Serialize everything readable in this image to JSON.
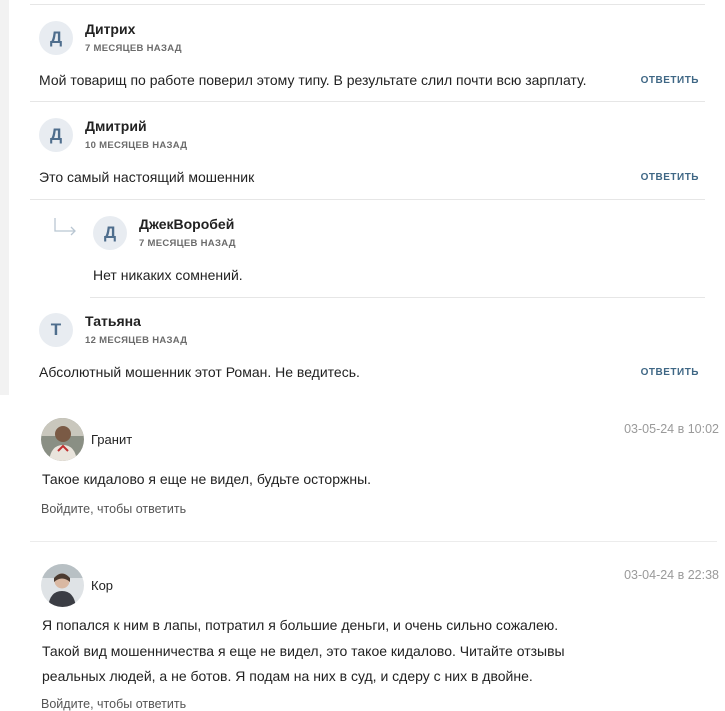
{
  "thread_a": [
    {
      "initial": "Д",
      "author": "Дитрих",
      "age": "7 МЕСЯЦЕВ НАЗАД",
      "text": "Мой товарищ по работе поверил этому типу. В результате слил почти всю зарплату.",
      "reply": "ОТВЕТИТЬ"
    },
    {
      "initial": "Д",
      "author": "Дмитрий",
      "age": "10 МЕСЯЦЕВ НАЗАД",
      "text": "Это самый настоящий мошенник",
      "reply": "ОТВЕТИТЬ"
    },
    {
      "initial": "Д",
      "author": "ДжекВоробей",
      "age": "7 МЕСЯЦЕВ НАЗАД",
      "text": "Нет никаких сомнений."
    },
    {
      "initial": "Т",
      "author": "Татьяна",
      "age": "12 МЕСЯЦЕВ НАЗАД",
      "text": "Абсолютный мошенник этот Роман. Не ведитесь.",
      "reply": "ОТВЕТИТЬ"
    }
  ],
  "thread_b": [
    {
      "name": "Гранит",
      "date": "03-05-24 в 10:02",
      "lines": [
        "Такое кидалово я еще не видел, будьте осторжны."
      ],
      "login_reply": "Войдите, чтобы ответить"
    },
    {
      "name": "Кор",
      "date": "03-04-24 в 22:38",
      "lines": [
        "Я попался к ним в лапы, потратил я большие деньги, и очень сильно сожалею.",
        "Такой вид мошенничества я еще не видел, это такое кидалово. Читайте отзывы",
        "реальных людей, а не ботов. Я подам на них в суд, и сдеру с них в двойне."
      ],
      "login_reply": "Войдите, чтобы ответить"
    }
  ],
  "colors": {
    "link": "#3f6785",
    "avatar_bg": "#e8ecf1",
    "avatar_fg": "#4f6e8d",
    "muted": "#9a9a9a"
  }
}
